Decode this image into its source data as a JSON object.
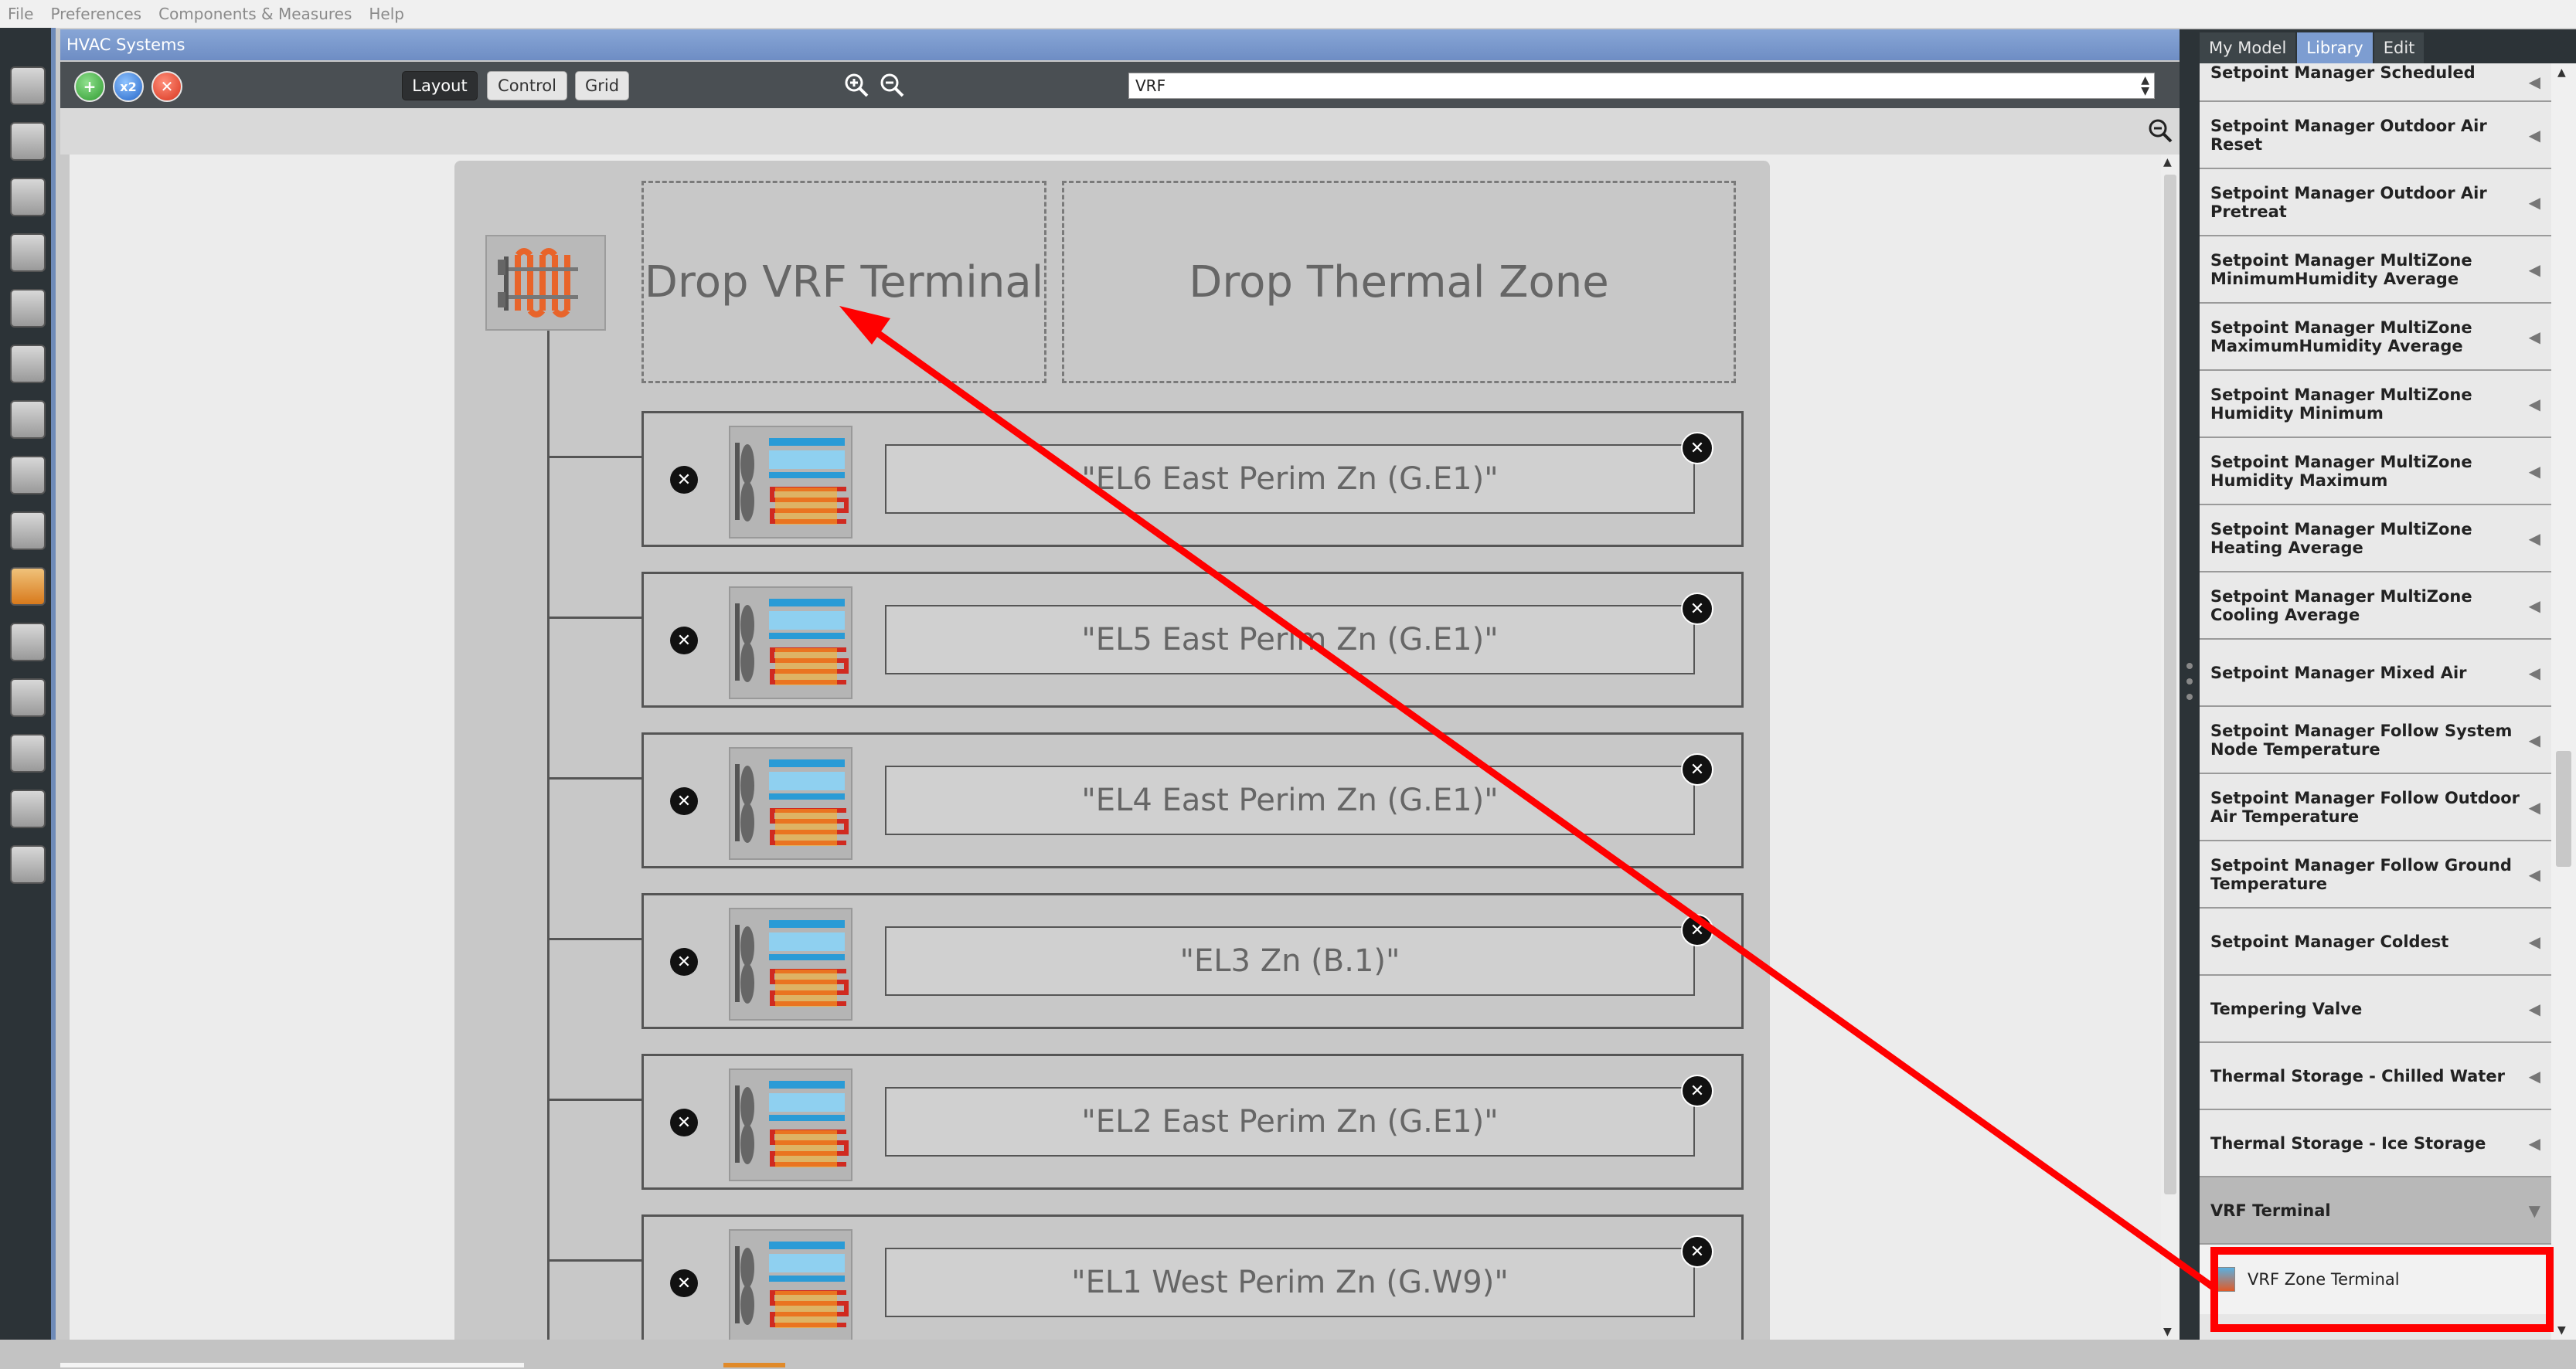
{
  "menu": [
    "File",
    "Preferences",
    "Components & Measures",
    "Help"
  ],
  "window": {
    "title": "HVAC Systems"
  },
  "toolbar": {
    "x2_label": "x2",
    "layout_label": "Layout",
    "control_label": "Control",
    "grid_label": "Grid",
    "system_select": "VRF"
  },
  "canvas": {
    "drop_vrf_label": "Drop VRF Terminal",
    "drop_zone_label": "Drop Thermal Zone",
    "zones": [
      {
        "name": "\"EL6 East Perim Zn (G.E1)\""
      },
      {
        "name": "\"EL5 East Perim Zn (G.E1)\""
      },
      {
        "name": "\"EL4 East Perim Zn (G.E1)\""
      },
      {
        "name": "\"EL3 Zn (B.1)\""
      },
      {
        "name": "\"EL2 East Perim Zn (G.E1)\""
      },
      {
        "name": "\"EL1 West Perim Zn (G.W9)\""
      }
    ]
  },
  "right_panel": {
    "tabs": [
      "My Model",
      "Library",
      "Edit"
    ],
    "active_tab": "Library",
    "items": [
      "Setpoint Manager Scheduled",
      "Setpoint Manager Outdoor Air Reset",
      "Setpoint Manager Outdoor Air Pretreat",
      "Setpoint Manager MultiZone MinimumHumidity Average",
      "Setpoint Manager MultiZone MaximumHumidity Average",
      "Setpoint Manager MultiZone Humidity Minimum",
      "Setpoint Manager MultiZone Humidity Maximum",
      "Setpoint Manager MultiZone Heating Average",
      "Setpoint Manager MultiZone Cooling Average",
      "Setpoint Manager Mixed Air",
      "Setpoint Manager Follow System Node Temperature",
      "Setpoint Manager Follow Outdoor Air Temperature",
      "Setpoint Manager Follow Ground Temperature",
      "Setpoint Manager Coldest",
      "Tempering Valve",
      "Thermal Storage - Chilled Water",
      "Thermal Storage - Ice Storage"
    ],
    "expanded_group": "VRF Terminal",
    "expanded_child": "VRF Zone Terminal"
  },
  "colors": {
    "annotation": "#ff0000",
    "title_bar": "#7a98cc",
    "active_tab": "#7d9dd1"
  }
}
